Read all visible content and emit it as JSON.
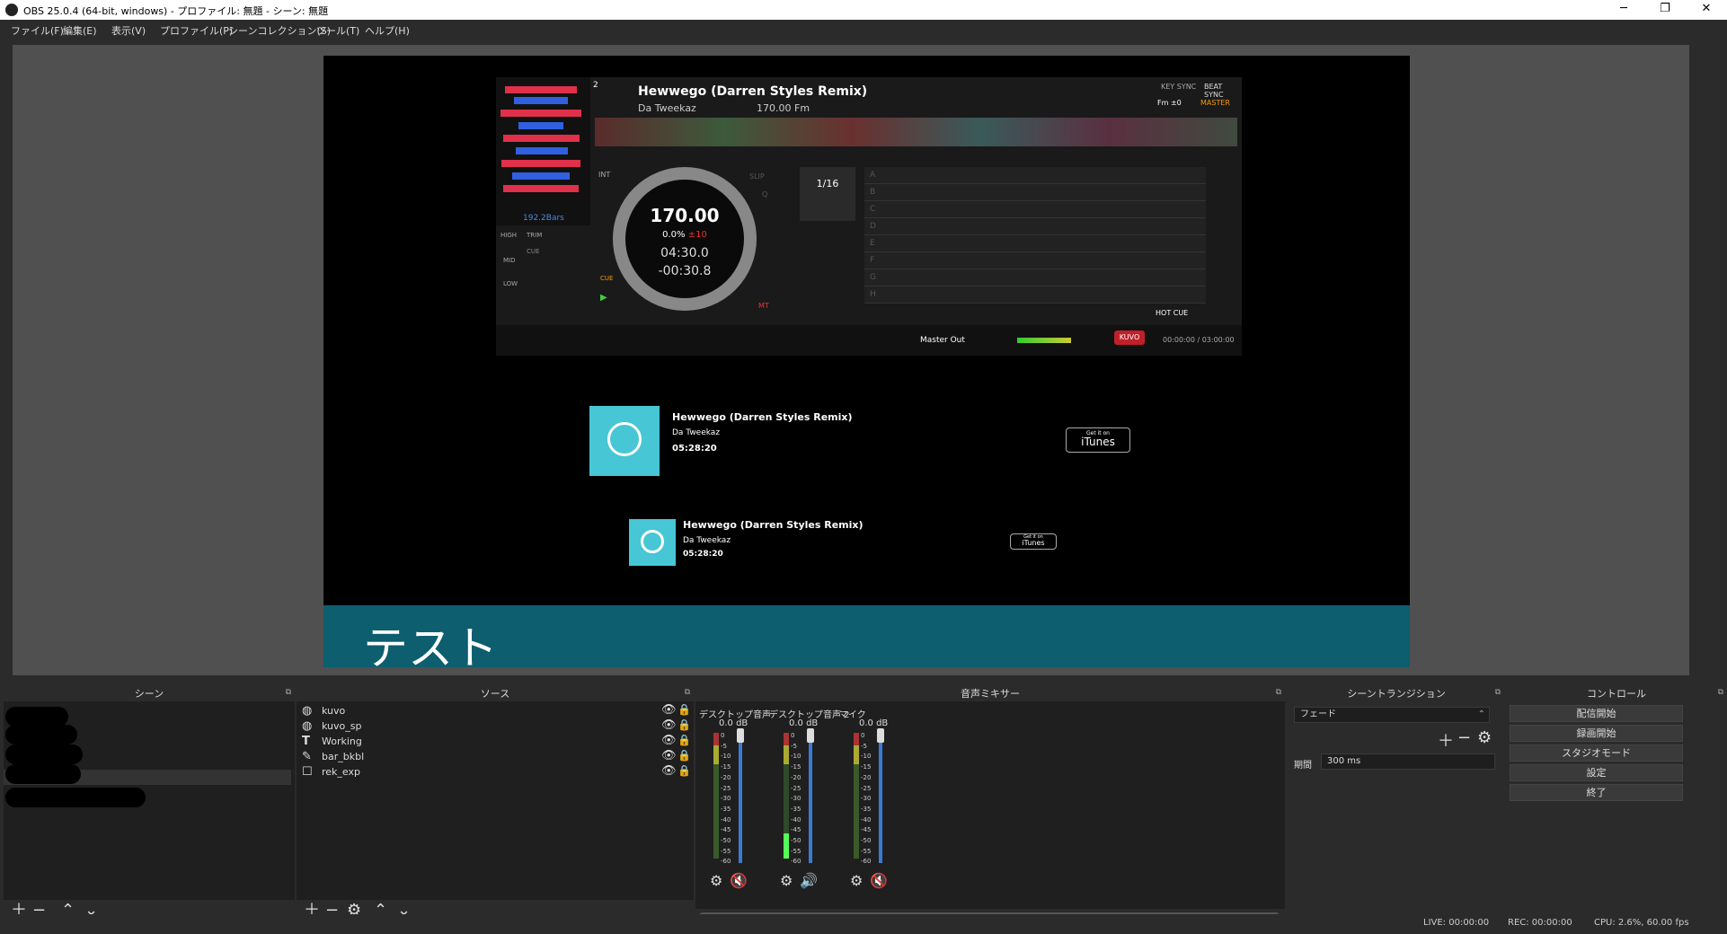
{
  "window": {
    "title": "OBS 25.0.4 (64-bit, windows) - プロファイル: 無題 - シーン: 無題"
  },
  "menu": [
    "ファイル(F)",
    "編集(E)",
    "表示(V)",
    "プロファイル(P)",
    "シーンコレクション(S)",
    "ツール(T)",
    "ヘルプ(H)"
  ],
  "preview": {
    "deck": {
      "deck_number": "2",
      "track": "Hewwego (Darren Styles Remix)",
      "artist": "Da Tweekaz",
      "key": "170.00 Fm",
      "bars": "192.2Bars",
      "bpm": "170.00",
      "pitch": "0.0%",
      "pitch_range": "±10",
      "elapsed": "04:30.0",
      "remain": "-00:30.8",
      "quantize": "1/16",
      "pads": [
        "A",
        "B",
        "C",
        "D",
        "E",
        "F",
        "G",
        "H"
      ],
      "hot_cue": "HOT CUE",
      "master_out": "Master Out",
      "brand": "KUVO",
      "time": "00:00:00 / 03:00:00",
      "labels": {
        "int": "INT",
        "slip": "SLIP",
        "q": "Q",
        "mt": "MT",
        "cue": "CUE",
        "key_sync": "KEY SYNC",
        "beat_sync": "BEAT SYNC",
        "master": "MASTER",
        "fm": "Fm ±0",
        "high": "HIGH",
        "trim": "TRIM",
        "mid": "MID",
        "low": "LOW",
        "cue_btn": "CUE"
      }
    },
    "nowplaying_large": {
      "title": "Hewwego (Darren Styles Remix)",
      "artist": "Da Tweekaz",
      "time": "05:28:20",
      "store": "iTunes",
      "store_pre": "Get it on"
    },
    "nowplaying_small": {
      "title": "Hewwego (Darren Styles Remix)",
      "artist": "Da Tweekaz",
      "time": "05:28:20",
      "store": "iTunes",
      "store_pre": "Get it on"
    },
    "banner_text": "テスト"
  },
  "docks": {
    "scenes": {
      "title": "シーン"
    },
    "sources": {
      "title": "ソース",
      "items": [
        {
          "name": "kuvo",
          "icon": "globe-icon"
        },
        {
          "name": "kuvo_sp",
          "icon": "globe-icon"
        },
        {
          "name": "Working",
          "icon": "text-icon"
        },
        {
          "name": "bar_bkbl",
          "icon": "brush-icon"
        },
        {
          "name": "rek_exp",
          "icon": "window-icon"
        }
      ]
    },
    "mixer": {
      "title": "音声ミキサー",
      "channels": [
        {
          "name": "デスクトップ音声",
          "db": "0.0 dB",
          "muted": true
        },
        {
          "name": "デスクトップ音声 2",
          "db": "0.0 dB",
          "muted": false
        },
        {
          "name": "マイク",
          "db": "0.0 dB",
          "muted": true
        }
      ],
      "scale": [
        "0",
        "-5",
        "-10",
        "-15",
        "-20",
        "-25",
        "-30",
        "-35",
        "-40",
        "-45",
        "-50",
        "-55",
        "-60"
      ]
    },
    "transitions": {
      "title": "シーントランジション",
      "selected": "フェード",
      "duration_label": "期間",
      "duration": "300 ms"
    },
    "controls": {
      "title": "コントロール",
      "buttons": [
        "配信開始",
        "録画開始",
        "スタジオモード",
        "設定",
        "終了"
      ]
    }
  },
  "status": {
    "live": "LIVE: 00:00:00",
    "rec": "REC: 00:00:00",
    "cpu": "CPU: 2.6%, 60.00 fps"
  },
  "colors": {
    "banner": "#0d5e6e",
    "cover": "#47c6d6",
    "fader": "#3a7bd5",
    "mute": "#e03030"
  }
}
